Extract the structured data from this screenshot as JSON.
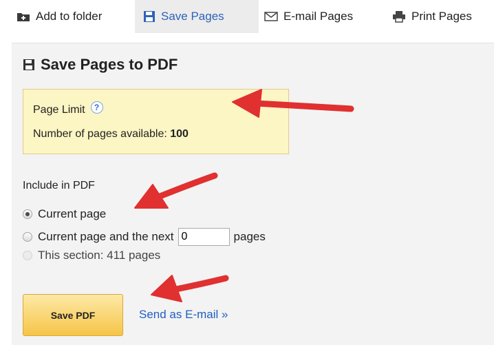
{
  "toolbar": {
    "add_to_folder": "Add to folder",
    "save_pages": "Save Pages",
    "email_pages": "E-mail Pages",
    "print_pages": "Print Pages"
  },
  "panel": {
    "title": "Save Pages to PDF",
    "page_limit": {
      "label": "Page Limit",
      "help": "?",
      "available_label": "Number of pages available:",
      "available_value": "100"
    },
    "include": {
      "label": "Include in PDF",
      "options": [
        {
          "label": "Current page",
          "checked": true
        },
        {
          "label": "Current page and the next",
          "suffix": "pages",
          "input_value": "0",
          "checked": false
        },
        {
          "label": "This section: 411 pages",
          "checked": false,
          "disabled": true
        }
      ]
    },
    "save_button": "Save PDF",
    "email_link": "Send as E-mail »"
  },
  "colors": {
    "accent_link": "#1f5fc1",
    "limit_box_bg": "#fcf5c4",
    "button_gold": "#f6c548",
    "annotation_arrow": "#e03030"
  },
  "icons": [
    "folder-add-icon",
    "floppy-disk-icon",
    "envelope-icon",
    "printer-icon",
    "help-icon"
  ]
}
